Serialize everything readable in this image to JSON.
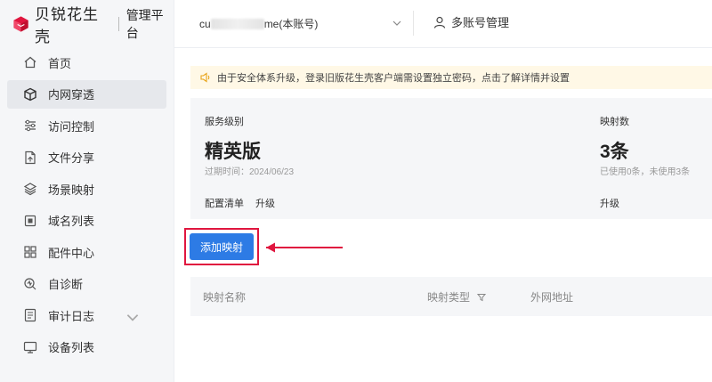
{
  "brand": {
    "name": "贝锐花生壳",
    "subtitle": "管理平台",
    "color": "#e0163f"
  },
  "sidebar": {
    "items": [
      {
        "label": "首页",
        "icon": "home-icon"
      },
      {
        "label": "内网穿透",
        "icon": "cube-icon",
        "active": true
      },
      {
        "label": "访问控制",
        "icon": "sliders-icon"
      },
      {
        "label": "文件分享",
        "icon": "file-share-icon"
      },
      {
        "label": "场景映射",
        "icon": "layers-icon"
      },
      {
        "label": "域名列表",
        "icon": "domain-icon"
      },
      {
        "label": "配件中心",
        "icon": "grid-icon"
      },
      {
        "label": "自诊断",
        "icon": "diagnose-icon"
      },
      {
        "label": "审计日志",
        "icon": "log-icon",
        "expandable": true
      },
      {
        "label": "设备列表",
        "icon": "monitor-icon"
      }
    ]
  },
  "header": {
    "account_prefix": "cu",
    "account_suffix": "me(本账号)",
    "multi_account": "多账号管理"
  },
  "notice": {
    "text": "由于安全体系升级，登录旧版花生壳客户端需设置独立密码，点击了解详情并设置",
    "bg_color": "#fff8e6"
  },
  "service": {
    "level_label": "服务级别",
    "level_value": "精英版",
    "expire": "过期时间：2024/06/23",
    "config_link": "配置清单",
    "upgrade_link": "升级"
  },
  "mapping": {
    "count_label": "映射数",
    "count_value": "3条",
    "usage": "已使用0条，未使用3条",
    "upgrade_link": "升级"
  },
  "actions": {
    "add_mapping": "添加映射",
    "accent_color": "#2d7be5",
    "highlight_color": "#e0163f"
  },
  "table": {
    "columns": [
      "映射名称",
      "映射类型",
      "外网地址"
    ]
  }
}
